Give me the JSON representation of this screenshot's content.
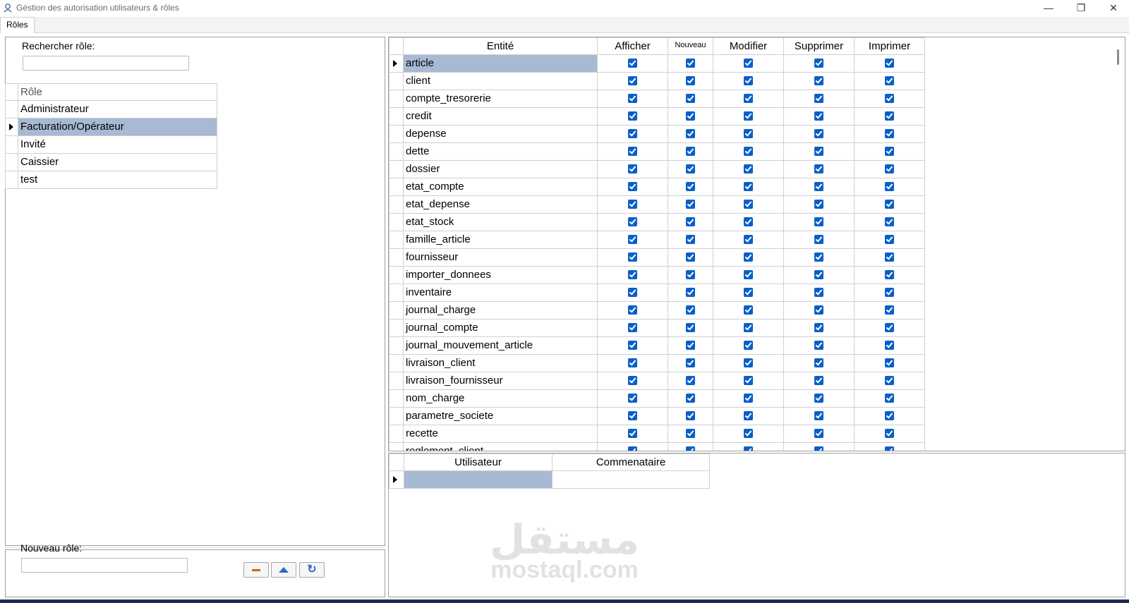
{
  "window": {
    "title": "Géstion des autorisation utilisateurs & rôles",
    "controls": {
      "minimize": "—",
      "maximize": "❐",
      "close": "✕"
    }
  },
  "tabs": [
    {
      "label": "Rôles",
      "active": true
    }
  ],
  "search": {
    "label": "Rechercher rôle:",
    "value": ""
  },
  "roles": {
    "header": "Rôle",
    "items": [
      "Administrateur",
      "Facturation/Opérateur",
      "Invité",
      "Caissier",
      "test"
    ],
    "selected_index": 1
  },
  "new_role": {
    "label": "Nouveau rôle:",
    "value": ""
  },
  "buttons": {
    "remove": "remove-icon",
    "move_up": "up-arrow-icon",
    "refresh": "refresh-icon"
  },
  "permissions": {
    "headers": [
      "Entité",
      "Afficher",
      "Nouveau",
      "Modifier",
      "Supprimer",
      "Imprimer"
    ],
    "rows": [
      "article",
      "client",
      "compte_tresorerie",
      "credit",
      "depense",
      "dette",
      "dossier",
      "etat_compte",
      "etat_depense",
      "etat_stock",
      "famille_article",
      "fournisseur",
      "importer_donnees",
      "inventaire",
      "journal_charge",
      "journal_compte",
      "journal_mouvement_article",
      "livraison_client",
      "livraison_fournisseur",
      "nom_charge",
      "parametre_societe",
      "recette",
      "reglement_client"
    ],
    "all_checked": true,
    "selected_index": 0
  },
  "users": {
    "headers": [
      "Utilisateur",
      "Commenataire"
    ],
    "rows": [
      {
        "user": "",
        "comment": ""
      }
    ]
  },
  "watermark": {
    "logo": "مستقل",
    "text": "mostaql.com"
  },
  "colors": {
    "selection": "#a7b9d3",
    "checkbox": "#0a5fc9"
  }
}
